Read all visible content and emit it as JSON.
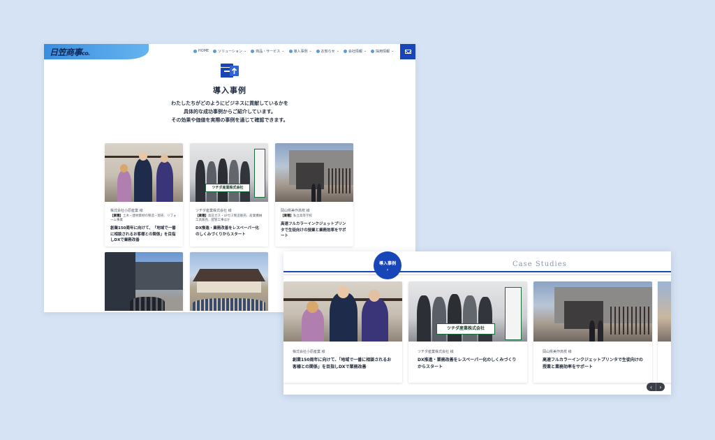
{
  "back_window": {
    "logo": {
      "main": "日笠商事",
      "suffix": "co."
    },
    "nav": [
      {
        "label": "HOME",
        "icon": "home-icon",
        "caret": ""
      },
      {
        "label": "ソリューション",
        "icon": "search-icon",
        "caret": "⌄"
      },
      {
        "label": "商品・サービス",
        "icon": "box-icon",
        "caret": "⌄"
      },
      {
        "label": "導入事例",
        "icon": "case-icon",
        "caret": "⌄"
      },
      {
        "label": "お知らせ",
        "icon": "info-icon",
        "caret": "⌄"
      },
      {
        "label": "会社情報",
        "icon": "building-icon",
        "caret": "⌄"
      },
      {
        "label": "採用情報",
        "icon": "person-icon",
        "caret": "⌄"
      }
    ],
    "page_title": "導入事例",
    "intro": [
      "わたしたちがどのようにビジネスに貢献しているかを",
      "具体的な成功事例からご紹介しています。",
      "その効果や価値を実際の事例を通じて確認できます。"
    ],
    "cards": [
      {
        "company": "株式会社小原産業 様",
        "industry_label": "【業種】",
        "industry": "土木・建材資材の製造・卸売、リフォーム事業",
        "headline": "創業150周年に向けて、「地域で一番に相談されるお客様との関係」を目指しDXで業務改善"
      },
      {
        "company": "ツチダ産業株式会社 様",
        "industry_label": "【業種】",
        "industry": "高圧ガス・LPガス製造販売、産業機械工具販売、配管工事ほか",
        "headline": "DX推進・業務改善をレスペーパー化のしくみづくりからスタート"
      },
      {
        "company": "岡山県美作高校 様",
        "industry_label": "【業種】",
        "industry": "私立高等学校",
        "headline": "高速フルカラーインクジェットプリンタで生徒向けの授業と業務効率をサポート"
      }
    ]
  },
  "front_window": {
    "badge_label": "導入事例",
    "badge_chevron": "›",
    "section_title": "Case Studies",
    "cards": [
      {
        "company": "株式会社小原産業 様",
        "headline": "創業150周年に向けて、「地域で一番に相談されるお客様との関係」を目指しDXで業務改善"
      },
      {
        "company": "ツチダ産業株式会社 様",
        "headline": "DX推進・業務改善をレスペーパー化のしくみづくりからスタート"
      },
      {
        "company": "岡山県美作高校 様",
        "headline": "高速フルカラーインクジェットプリンタで生徒向けの授業と業務効率をサポート"
      }
    ],
    "prev_label": "‹",
    "next_label": "›"
  },
  "photo_banner_text": "ツチダ産業株式会社",
  "colors": {
    "brand_blue": "#1846b8",
    "background": "#d6e3f4"
  }
}
